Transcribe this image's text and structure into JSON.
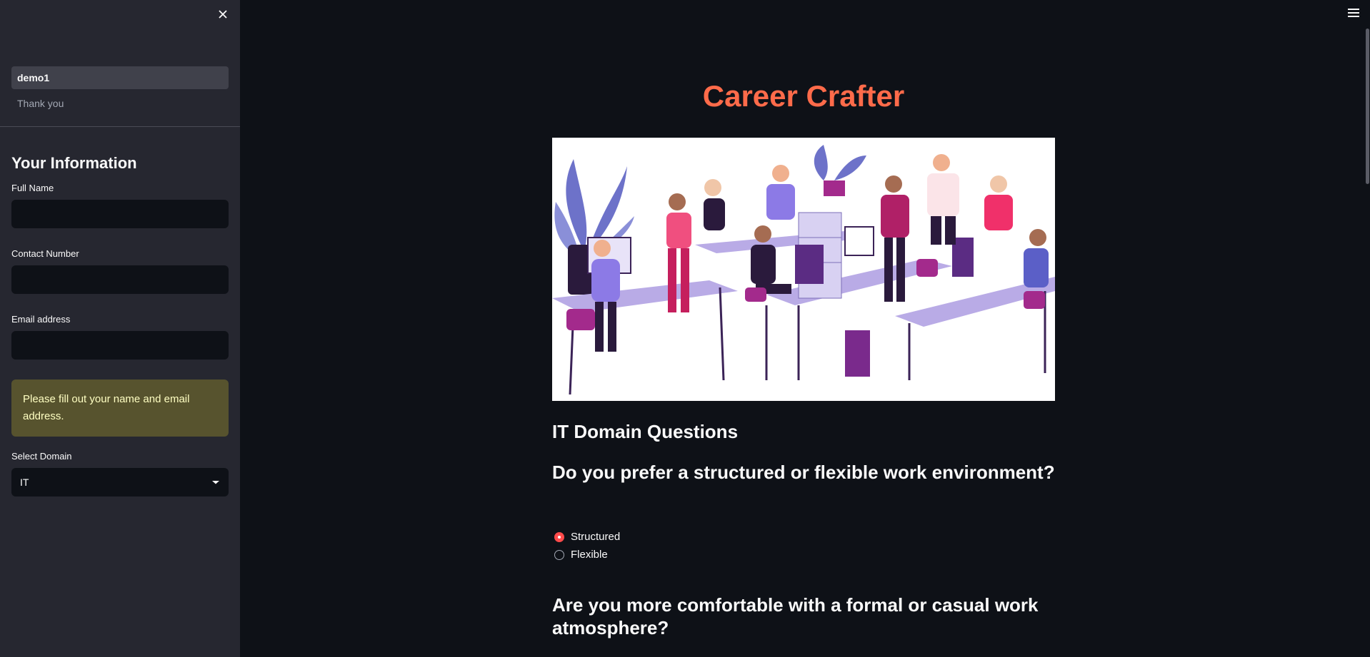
{
  "sidebar": {
    "nav": [
      {
        "label": "demo1",
        "active": true
      },
      {
        "label": "Thank you",
        "active": false
      }
    ],
    "title": "Your Information",
    "fields": {
      "full_name": {
        "label": "Full Name",
        "value": ""
      },
      "contact_number": {
        "label": "Contact Number",
        "value": ""
      },
      "email": {
        "label": "Email address",
        "value": ""
      }
    },
    "warning": "Please fill out your name and email address.",
    "domain": {
      "label": "Select Domain",
      "value": "IT"
    }
  },
  "main": {
    "title": "Career Crafter",
    "section_heading": "IT Domain Questions",
    "question1": {
      "text": "Do you prefer a structured or flexible work environment?",
      "options": [
        "Structured",
        "Flexible"
      ],
      "selected": "Structured"
    },
    "question2": {
      "text": "Are you more comfortable with a formal or casual work atmosphere?"
    }
  },
  "colors": {
    "background": "#0e1117",
    "sidebar": "#262730",
    "title_accent": "#ff6b4a",
    "radio_accent": "#ff4b4b",
    "warning_bg": "#57532e",
    "warning_text": "#ffffc2"
  },
  "icons": [
    "close-icon",
    "chevron-down-icon",
    "hamburger-menu-icon"
  ]
}
